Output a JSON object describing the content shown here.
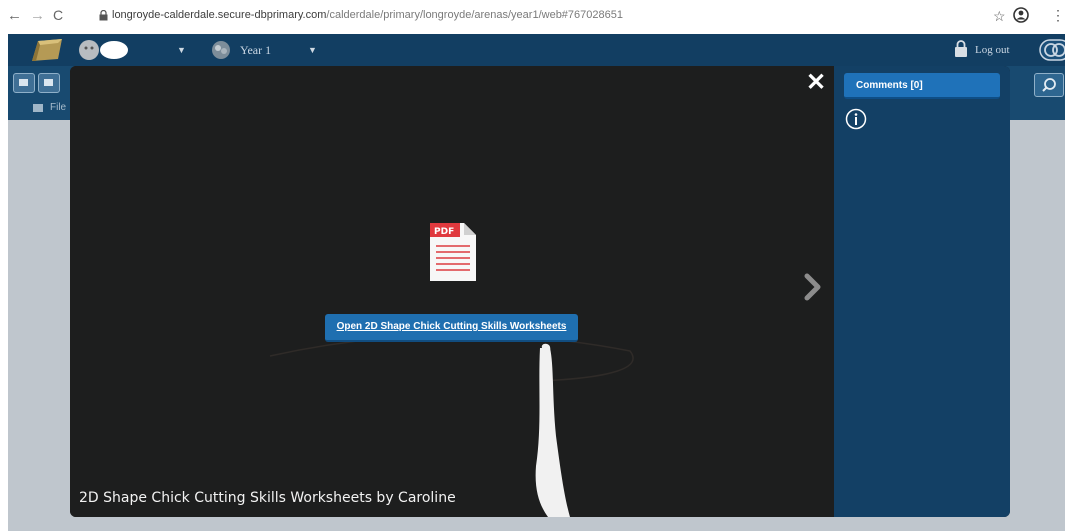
{
  "browser": {
    "url_host": "longroyde-calderdale.secure-dbprimary.com",
    "url_path": "/calderdale/primary/longroyde/arenas/year1/web#767028651"
  },
  "header": {
    "year_label": "Year 1",
    "logout_label": "Log out"
  },
  "underlying": {
    "files_label": "File"
  },
  "viewer": {
    "file_badge": "PDF",
    "open_button_label": "Open 2D Shape Chick Cutting Skills Worksheets",
    "caption": "2D Shape Chick Cutting Skills Worksheets by Caroline"
  },
  "sidebar": {
    "comments_label": "Comments [0]"
  },
  "colors": {
    "header_bg": "#123e62",
    "viewer_bg": "#1d1e1e",
    "sidepanel_bg": "#134065",
    "button_blue": "#1f72b9",
    "pdf_red": "#e0393e"
  },
  "icons": [
    "back-icon",
    "forward-icon",
    "reload-icon",
    "lock-icon",
    "star-icon",
    "account-icon",
    "kebab-menu-icon",
    "close-icon",
    "info-icon",
    "pdf-file-icon",
    "next-arrow-icon",
    "padlock-icon",
    "search-icon"
  ]
}
